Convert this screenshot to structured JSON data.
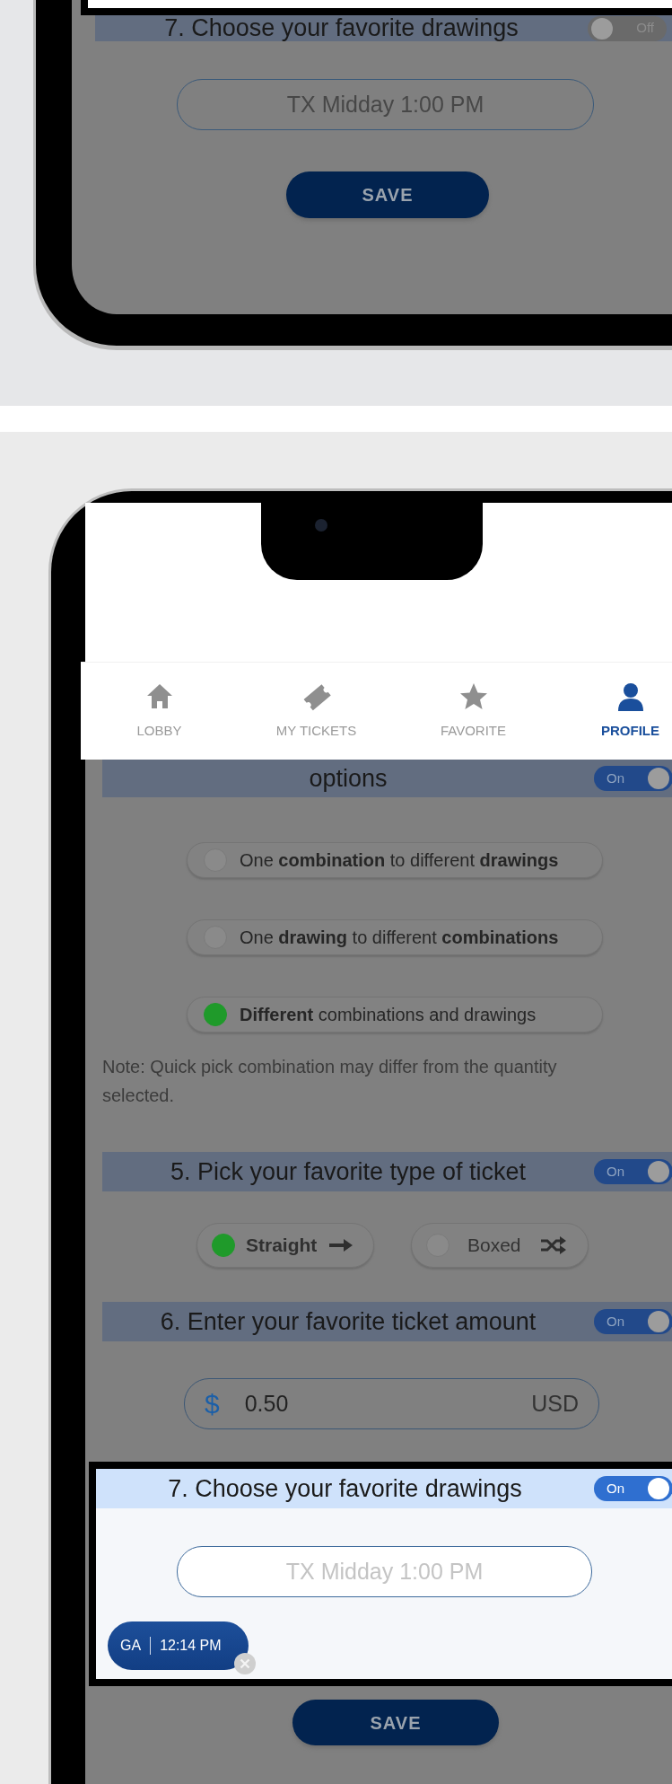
{
  "top_screen": {
    "section": {
      "title": "7. Choose your favorite drawings",
      "highlighted": false,
      "toggle": {
        "label": "Off",
        "on": false
      }
    },
    "drawing_field": {
      "placeholder": "TX Midday 1:00 PM"
    },
    "save_button": "SAVE"
  },
  "bottom_screen": {
    "nav": [
      {
        "label": "LOBBY",
        "selected": false
      },
      {
        "label": "MY TICKETS",
        "selected": false
      },
      {
        "label": "FAVORITE",
        "selected": false
      },
      {
        "label": "PROFILE",
        "selected": true
      }
    ],
    "quick_pick_section": {
      "title": "options",
      "highlighted": false,
      "toggle": {
        "label": "On",
        "on": true
      },
      "options": [
        {
          "text": "One **combination** to different **drawings**",
          "selected": false
        },
        {
          "text": "One **drawing** to different **combinations**",
          "selected": false
        },
        {
          "text": "**Different** combinations and drawings",
          "selected": true
        }
      ],
      "note": "Note: Quick pick combination may differ from the quantity selected."
    },
    "ticket_type_section": {
      "title": "5. Pick your favorite type of ticket",
      "highlighted": false,
      "toggle": {
        "label": "On",
        "on": true
      },
      "types": [
        {
          "label": "Straight",
          "selected": true
        },
        {
          "label": "Boxed",
          "selected": false
        }
      ]
    },
    "amount_section": {
      "title": "6. Enter your favorite ticket amount",
      "highlighted": false,
      "toggle": {
        "label": "On",
        "on": true
      },
      "amount_field": {
        "currency": "$",
        "value": "0.50",
        "unit": "USD"
      }
    },
    "drawings_section": {
      "title": "7. Choose your favorite drawings",
      "highlighted": true,
      "toggle": {
        "label": "On",
        "on": true
      },
      "drawing_field": {
        "placeholder": "TX Midday 1:00 PM"
      },
      "chips": [
        {
          "state": "GA",
          "time": "12:14 PM"
        }
      ]
    },
    "save_button": "SAVE"
  }
}
